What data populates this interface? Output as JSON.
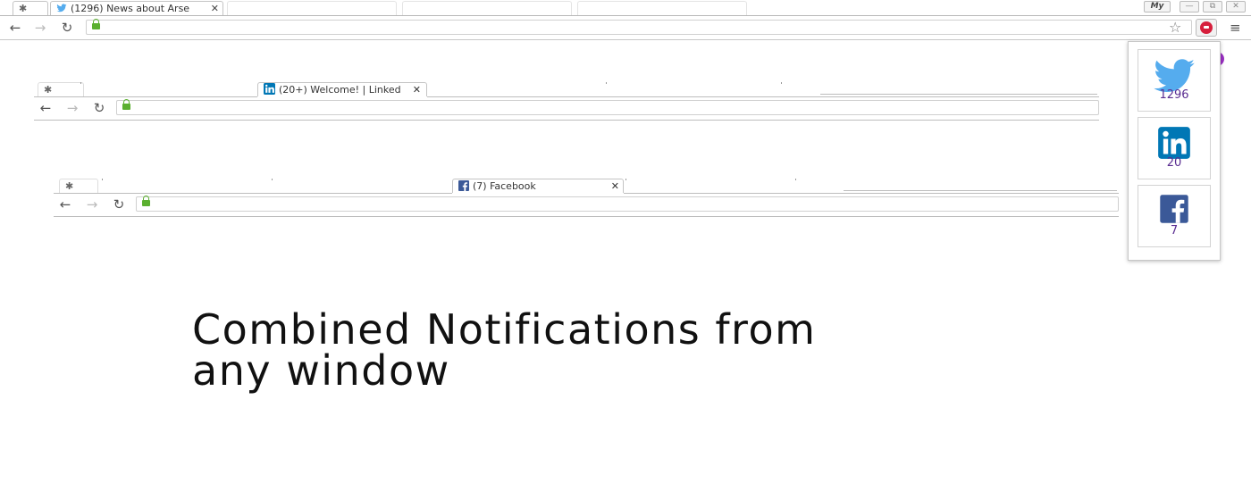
{
  "main_window": {
    "tabs": [
      {
        "title": "",
        "icon": "puzzle-icon"
      },
      {
        "title": "(1296) News about Arse",
        "icon": "twitter-icon"
      },
      {
        "title": ""
      },
      {
        "title": ""
      },
      {
        "title": ""
      }
    ],
    "profile_label": "My",
    "window_controls": [
      "minimize",
      "restore",
      "close"
    ]
  },
  "window_2": {
    "tab": {
      "title": "(20+) Welcome! | Linked",
      "icon": "linkedin-icon"
    }
  },
  "window_3": {
    "tab": {
      "title": "(7) Facebook",
      "icon": "facebook-icon"
    }
  },
  "popup": {
    "items": [
      {
        "network": "twitter",
        "count": "1296"
      },
      {
        "network": "linkedin",
        "count": "20"
      },
      {
        "network": "facebook",
        "count": "7"
      }
    ]
  },
  "headline": {
    "line1": "Combined Notifications from",
    "line2": "any window"
  },
  "colors": {
    "twitter": "#55acee",
    "linkedin": "#0077b5",
    "facebook": "#3b5998",
    "count_text": "#5a2d91",
    "lock": "#5bb030",
    "extension_badge": "#d61f3c"
  }
}
